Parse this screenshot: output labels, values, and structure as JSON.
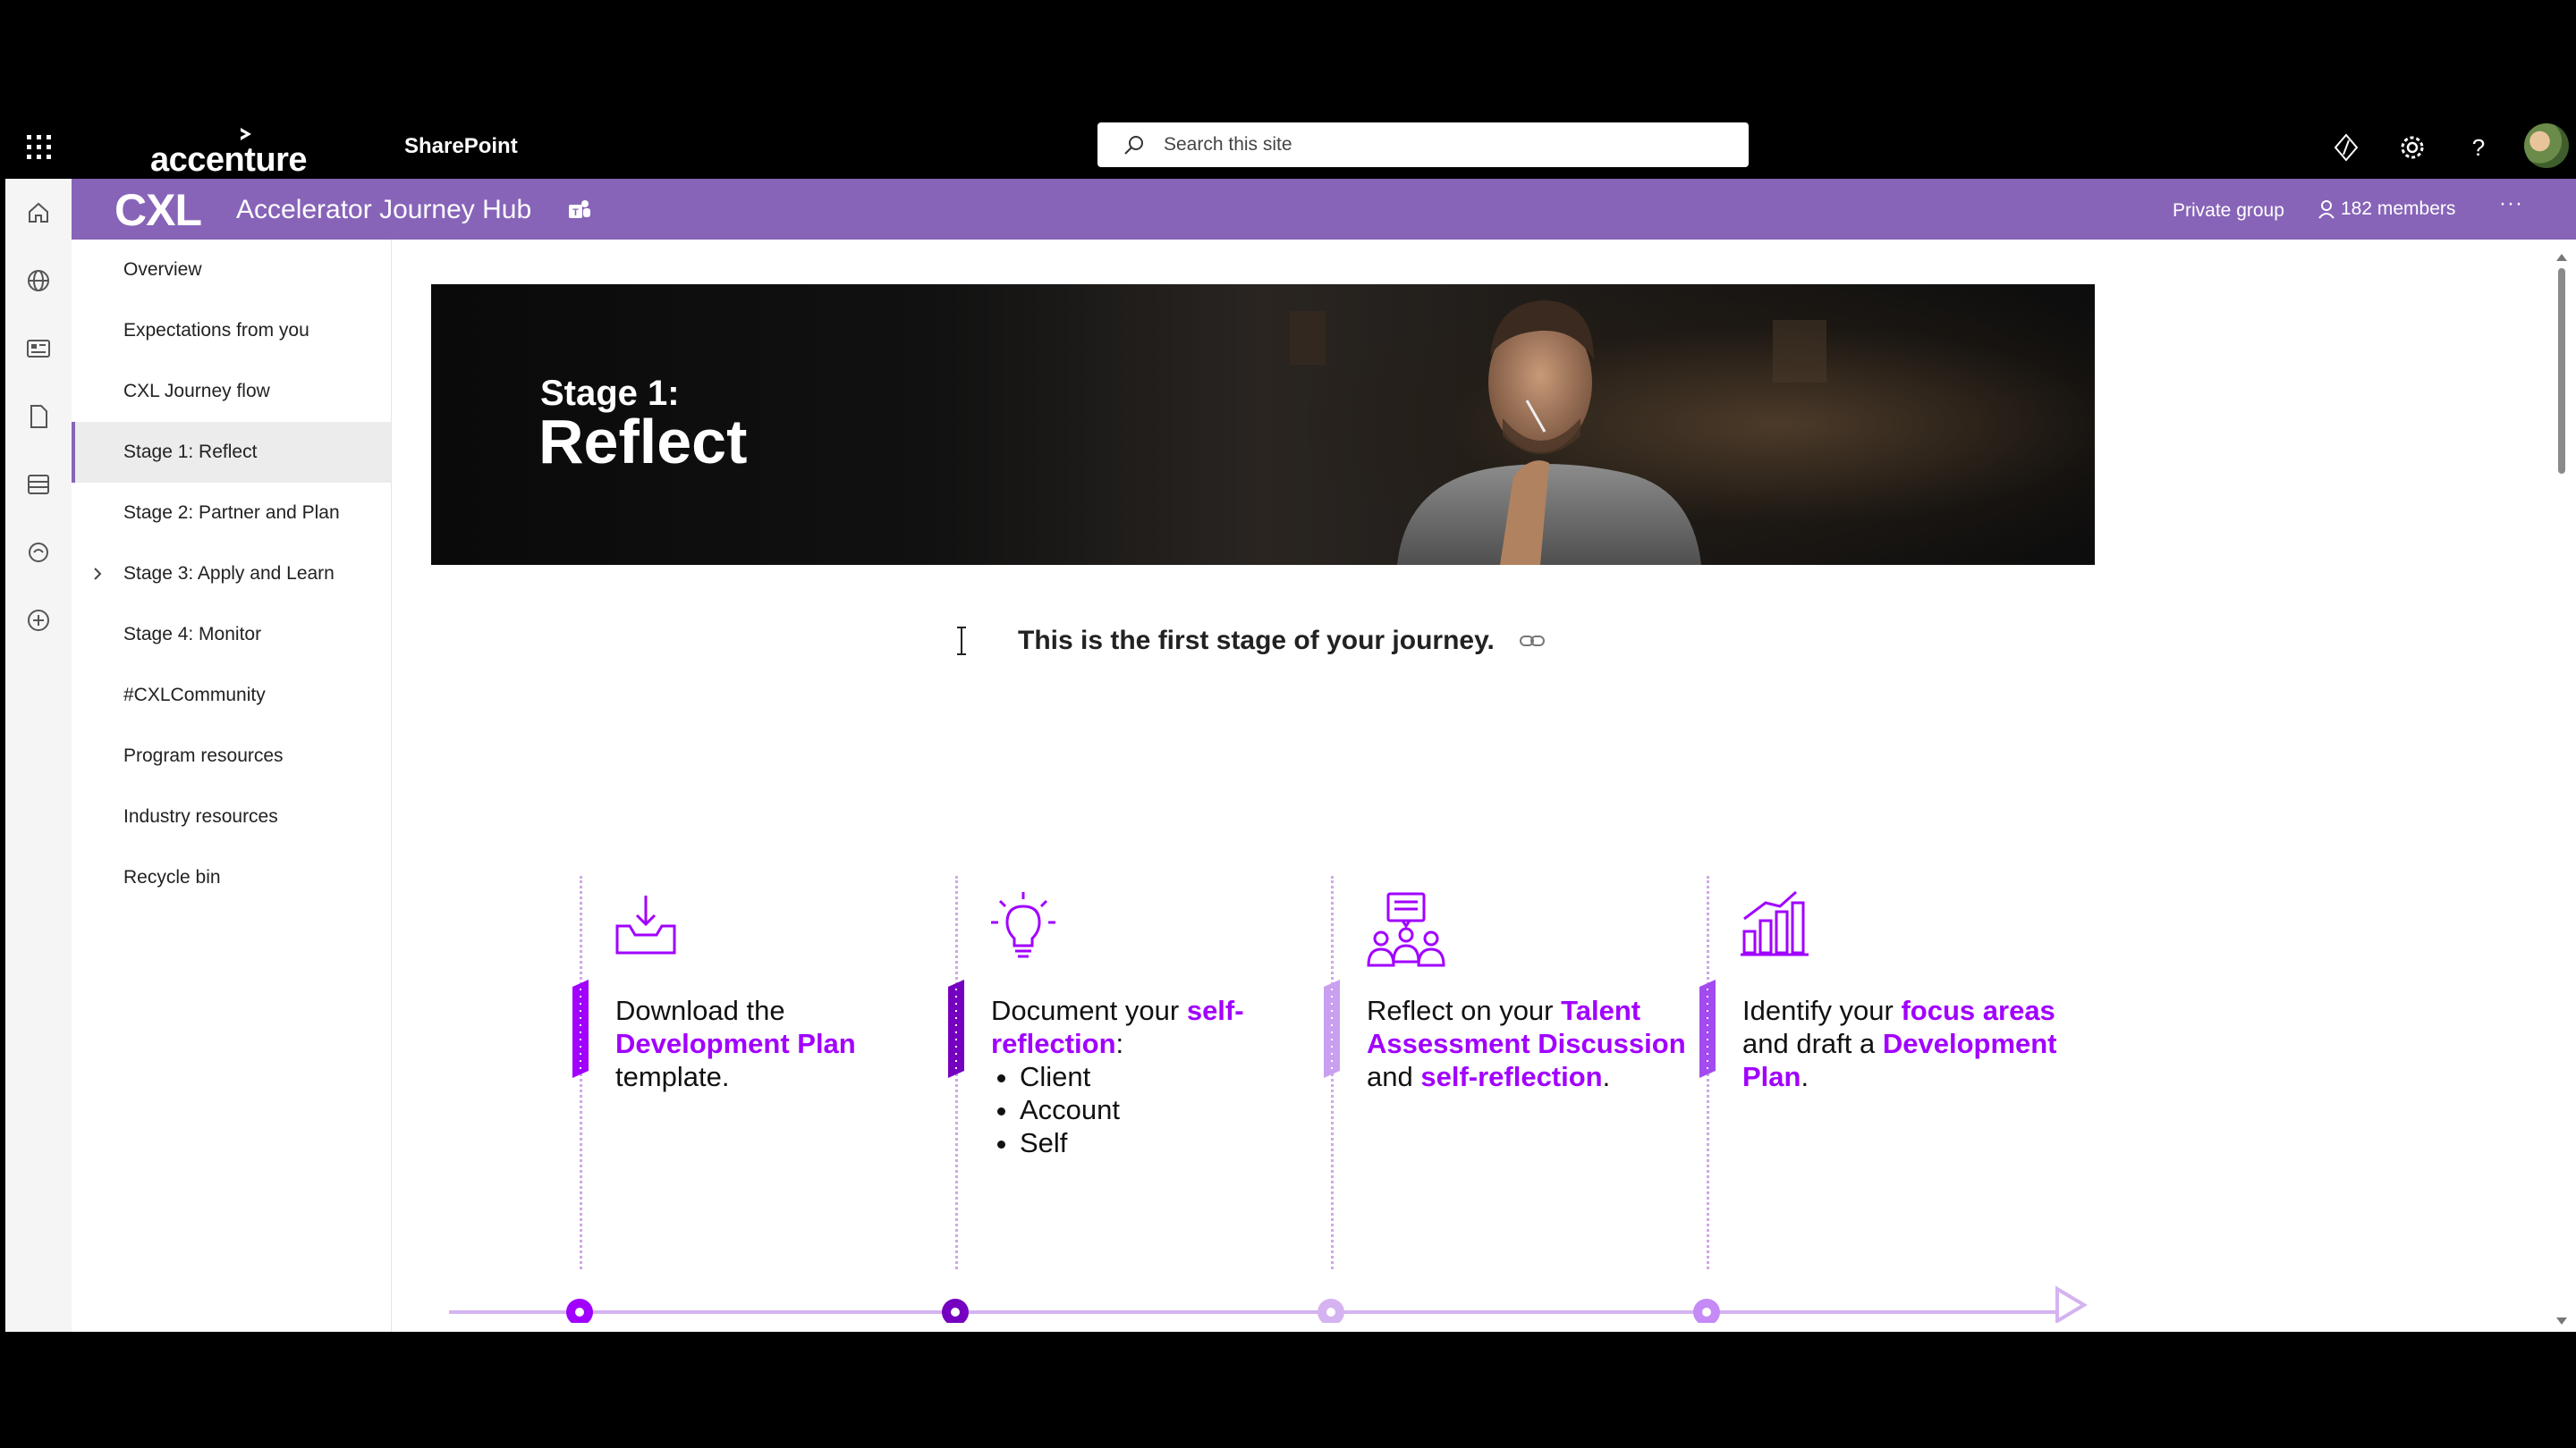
{
  "suite": {
    "logo_text": "accenture",
    "app_name": "SharePoint",
    "search_placeholder": "Search this site"
  },
  "site": {
    "logo": "CXL",
    "title": "Accelerator Journey Hub",
    "privacy": "Private group",
    "members": "182 members"
  },
  "nav": {
    "items": [
      {
        "label": "Overview"
      },
      {
        "label": "Expectations from you"
      },
      {
        "label": "CXL Journey flow"
      },
      {
        "label": "Stage 1: Reflect"
      },
      {
        "label": "Stage 2: Partner and Plan"
      },
      {
        "label": "Stage 3: Apply and Learn"
      },
      {
        "label": "Stage 4: Monitor"
      },
      {
        "label": "#CXLCommunity"
      },
      {
        "label": "Program resources"
      },
      {
        "label": "Industry resources"
      },
      {
        "label": "Recycle bin"
      }
    ],
    "active_index": 3
  },
  "hero": {
    "stage_label": "Stage 1:",
    "stage_name": "Reflect"
  },
  "content": {
    "intro": "This is the first stage of your journey."
  },
  "steps": [
    {
      "icon": "inbox-download-icon",
      "parts": [
        "Download the ",
        "Development Plan",
        " template."
      ]
    },
    {
      "icon": "lightbulb-icon",
      "parts": [
        "Document your ",
        "self-reflection",
        ":"
      ],
      "bullets": [
        "Client",
        "Account",
        "Self"
      ]
    },
    {
      "icon": "discussion-group-icon",
      "parts": [
        "Reflect on your ",
        "Talent Assessment Discussion",
        " and ",
        "self-reflection",
        "."
      ]
    },
    {
      "icon": "bar-chart-growth-icon",
      "parts": [
        "Identify your ",
        "focus areas",
        " and draft a ",
        "Development Plan",
        "."
      ]
    }
  ],
  "colors": {
    "site_header": "#8764b8",
    "accent_purple": "#a100ff",
    "timeline_line": "#d4b3f0"
  }
}
